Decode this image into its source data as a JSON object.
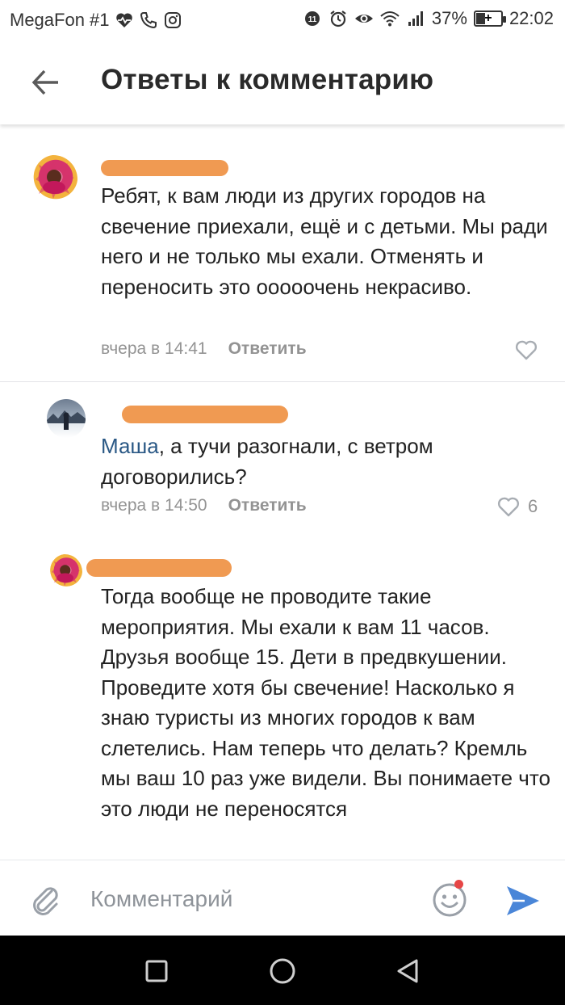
{
  "status_bar": {
    "carrier": "MegaFon #1",
    "battery_percent": "37%",
    "battery_level": 0.37,
    "time": "22:02",
    "icons_left": [
      "heart-pulse-icon",
      "phone-icon",
      "camera-icon"
    ],
    "icons_right": [
      "data-saver-icon",
      "alarm-icon",
      "eye-icon",
      "wifi-icon",
      "signal-icon",
      "battery-icon"
    ]
  },
  "header": {
    "back_icon": "arrow-left-icon",
    "title": "Ответы к комментарию"
  },
  "comments": [
    {
      "text": "Ребят, к вам люди из других городов на свечение приехали, ещё и с детьми. Мы ради него и не только мы ехали. Отменять и переносить это ооооочень некрасиво.",
      "time": "вчера в 14:41",
      "reply_label": "Ответить",
      "likes": ""
    },
    {
      "mention": "Маша",
      "text": ", а тучи разогнали, с ветром договорились?",
      "time": "вчера в 14:50",
      "reply_label": "Ответить",
      "likes": "6"
    },
    {
      "text": "Тогда вообще не проводите такие мероприятия. Мы ехали к вам 11 часов. Друзья вообще 15. Дети в предвкушении. Проведите хотя бы свечение! Насколько я знаю туристы из многих городов к вам слетелись. Нам теперь что делать? Кремль мы ваш 10 раз уже видели. Вы понимаете что это люди не переносятся"
    }
  ],
  "composer": {
    "placeholder": "Комментарий",
    "icons": [
      "paperclip-icon",
      "emoji-icon",
      "send-icon"
    ]
  },
  "nav": [
    "recents-icon",
    "home-icon",
    "back-triangle-icon"
  ],
  "colors": {
    "link": "#2a5885",
    "meta": "#939393",
    "redaction": "#f09a52",
    "send": "#4a86d8"
  }
}
